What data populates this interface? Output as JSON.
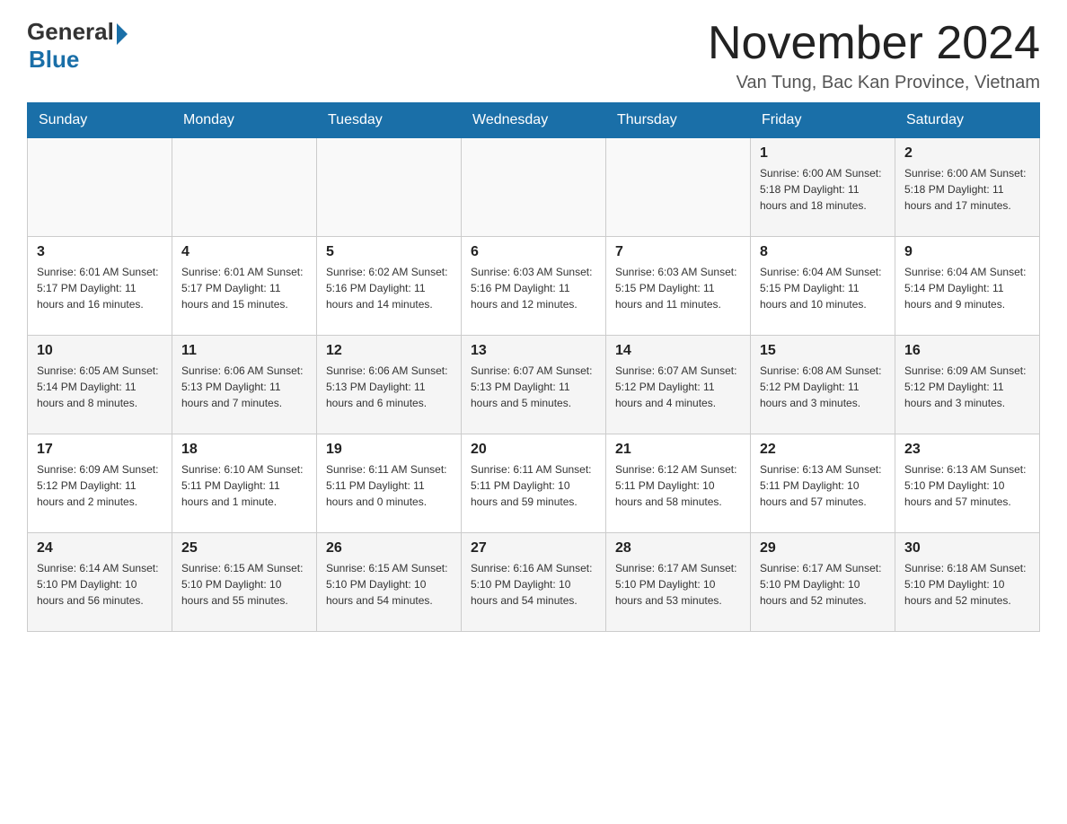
{
  "header": {
    "logo_general": "General",
    "logo_blue": "Blue",
    "month_title": "November 2024",
    "location": "Van Tung, Bac Kan Province, Vietnam"
  },
  "calendar": {
    "days_of_week": [
      "Sunday",
      "Monday",
      "Tuesday",
      "Wednesday",
      "Thursday",
      "Friday",
      "Saturday"
    ],
    "weeks": [
      [
        {
          "day": "",
          "info": ""
        },
        {
          "day": "",
          "info": ""
        },
        {
          "day": "",
          "info": ""
        },
        {
          "day": "",
          "info": ""
        },
        {
          "day": "",
          "info": ""
        },
        {
          "day": "1",
          "info": "Sunrise: 6:00 AM\nSunset: 5:18 PM\nDaylight: 11 hours and 18 minutes."
        },
        {
          "day": "2",
          "info": "Sunrise: 6:00 AM\nSunset: 5:18 PM\nDaylight: 11 hours and 17 minutes."
        }
      ],
      [
        {
          "day": "3",
          "info": "Sunrise: 6:01 AM\nSunset: 5:17 PM\nDaylight: 11 hours and 16 minutes."
        },
        {
          "day": "4",
          "info": "Sunrise: 6:01 AM\nSunset: 5:17 PM\nDaylight: 11 hours and 15 minutes."
        },
        {
          "day": "5",
          "info": "Sunrise: 6:02 AM\nSunset: 5:16 PM\nDaylight: 11 hours and 14 minutes."
        },
        {
          "day": "6",
          "info": "Sunrise: 6:03 AM\nSunset: 5:16 PM\nDaylight: 11 hours and 12 minutes."
        },
        {
          "day": "7",
          "info": "Sunrise: 6:03 AM\nSunset: 5:15 PM\nDaylight: 11 hours and 11 minutes."
        },
        {
          "day": "8",
          "info": "Sunrise: 6:04 AM\nSunset: 5:15 PM\nDaylight: 11 hours and 10 minutes."
        },
        {
          "day": "9",
          "info": "Sunrise: 6:04 AM\nSunset: 5:14 PM\nDaylight: 11 hours and 9 minutes."
        }
      ],
      [
        {
          "day": "10",
          "info": "Sunrise: 6:05 AM\nSunset: 5:14 PM\nDaylight: 11 hours and 8 minutes."
        },
        {
          "day": "11",
          "info": "Sunrise: 6:06 AM\nSunset: 5:13 PM\nDaylight: 11 hours and 7 minutes."
        },
        {
          "day": "12",
          "info": "Sunrise: 6:06 AM\nSunset: 5:13 PM\nDaylight: 11 hours and 6 minutes."
        },
        {
          "day": "13",
          "info": "Sunrise: 6:07 AM\nSunset: 5:13 PM\nDaylight: 11 hours and 5 minutes."
        },
        {
          "day": "14",
          "info": "Sunrise: 6:07 AM\nSunset: 5:12 PM\nDaylight: 11 hours and 4 minutes."
        },
        {
          "day": "15",
          "info": "Sunrise: 6:08 AM\nSunset: 5:12 PM\nDaylight: 11 hours and 3 minutes."
        },
        {
          "day": "16",
          "info": "Sunrise: 6:09 AM\nSunset: 5:12 PM\nDaylight: 11 hours and 3 minutes."
        }
      ],
      [
        {
          "day": "17",
          "info": "Sunrise: 6:09 AM\nSunset: 5:12 PM\nDaylight: 11 hours and 2 minutes."
        },
        {
          "day": "18",
          "info": "Sunrise: 6:10 AM\nSunset: 5:11 PM\nDaylight: 11 hours and 1 minute."
        },
        {
          "day": "19",
          "info": "Sunrise: 6:11 AM\nSunset: 5:11 PM\nDaylight: 11 hours and 0 minutes."
        },
        {
          "day": "20",
          "info": "Sunrise: 6:11 AM\nSunset: 5:11 PM\nDaylight: 10 hours and 59 minutes."
        },
        {
          "day": "21",
          "info": "Sunrise: 6:12 AM\nSunset: 5:11 PM\nDaylight: 10 hours and 58 minutes."
        },
        {
          "day": "22",
          "info": "Sunrise: 6:13 AM\nSunset: 5:11 PM\nDaylight: 10 hours and 57 minutes."
        },
        {
          "day": "23",
          "info": "Sunrise: 6:13 AM\nSunset: 5:10 PM\nDaylight: 10 hours and 57 minutes."
        }
      ],
      [
        {
          "day": "24",
          "info": "Sunrise: 6:14 AM\nSunset: 5:10 PM\nDaylight: 10 hours and 56 minutes."
        },
        {
          "day": "25",
          "info": "Sunrise: 6:15 AM\nSunset: 5:10 PM\nDaylight: 10 hours and 55 minutes."
        },
        {
          "day": "26",
          "info": "Sunrise: 6:15 AM\nSunset: 5:10 PM\nDaylight: 10 hours and 54 minutes."
        },
        {
          "day": "27",
          "info": "Sunrise: 6:16 AM\nSunset: 5:10 PM\nDaylight: 10 hours and 54 minutes."
        },
        {
          "day": "28",
          "info": "Sunrise: 6:17 AM\nSunset: 5:10 PM\nDaylight: 10 hours and 53 minutes."
        },
        {
          "day": "29",
          "info": "Sunrise: 6:17 AM\nSunset: 5:10 PM\nDaylight: 10 hours and 52 minutes."
        },
        {
          "day": "30",
          "info": "Sunrise: 6:18 AM\nSunset: 5:10 PM\nDaylight: 10 hours and 52 minutes."
        }
      ]
    ]
  }
}
